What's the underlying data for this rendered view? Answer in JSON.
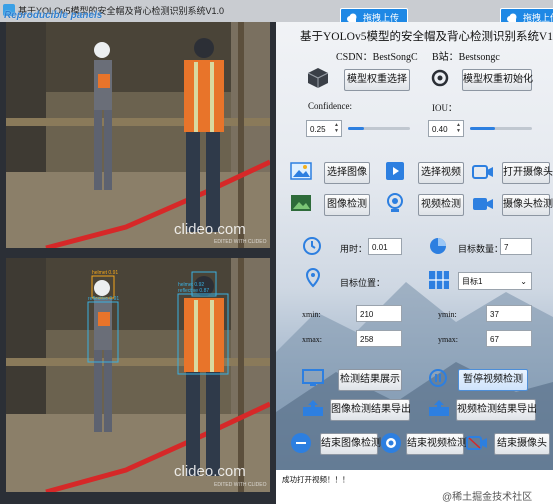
{
  "window": {
    "title": "基于YOLOv5模型的安全帽及背心检测识别系统V1.0",
    "overlay_brand": "Reproducible panels"
  },
  "top_buttons": {
    "drag_upload": "拖拽上传"
  },
  "video": {
    "watermark": "clideo.com",
    "watermark_sub": "EDITED WITH CLIDEO",
    "detections": [
      {
        "label": "helmet 0.91"
      },
      {
        "label": "helmet 0.92"
      },
      {
        "label": "reflective 0.91"
      },
      {
        "label": "reflective 0.87"
      }
    ]
  },
  "panel": {
    "title": "基于YOLOv5模型的安全帽及背心检测识别系统V1.0",
    "csdn": "CSDN：BestSongC",
    "bilibili": "B站：Bestsongc",
    "model_select": "模型权重选择",
    "model_init": "模型权重初始化",
    "confidence_label": "Confidence:",
    "confidence_value": "0.25",
    "confidence_level": 0.25,
    "iou_label": "IOU：",
    "iou_value": "0.40",
    "iou_level": 0.4,
    "select_image": "选择图像",
    "select_video": "选择视频",
    "open_camera": "打开摄像头",
    "image_detect": "图像检测",
    "video_detect": "视频检测",
    "camera_detect": "摄像头检测",
    "time_label": "用时：",
    "time_value": "0.01",
    "count_label": "目标数量：",
    "count_value": "7",
    "position_label": "目标位置：",
    "target_select": "目标1",
    "xmin_label": "xmin:",
    "xmin_value": "210",
    "ymin_label": "ymin:",
    "ymin_value": "37",
    "xmax_label": "xmax:",
    "xmax_value": "258",
    "ymax_label": "ymax:",
    "ymax_value": "67",
    "show_results": "检测结果展示",
    "pause_video": "暂停视频检测",
    "export_image": "图像检测结果导出",
    "export_video": "视频检测结果导出",
    "end_image": "结束图像检测",
    "end_video": "结束视频检测",
    "end_camera": "结束摄像头",
    "status": "成功打开视频！！！",
    "credit": "@稀土掘金技术社区"
  },
  "colors": {
    "accent": "#1e88e5",
    "vest": "#e8742a",
    "tape": "#d62828"
  }
}
